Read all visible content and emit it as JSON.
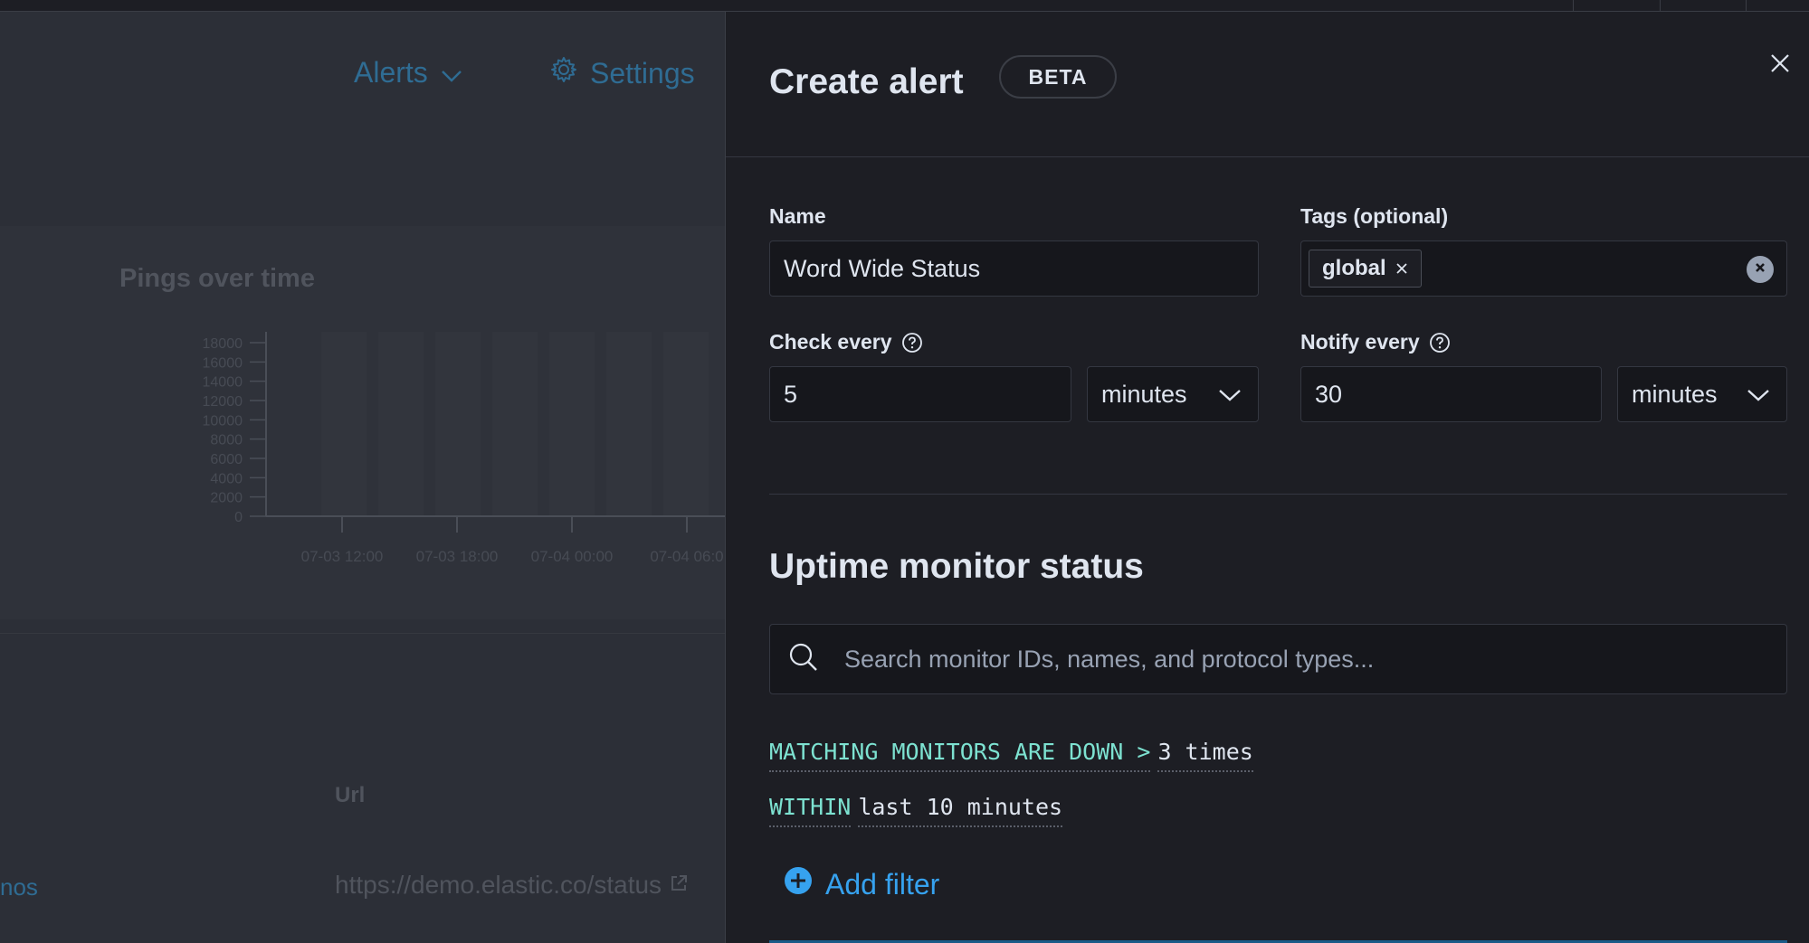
{
  "background": {
    "nav": {
      "alerts_label": "Alerts",
      "settings_label": "Settings"
    },
    "chart": {
      "title": "Pings over time"
    },
    "table": {
      "url_header": "Url",
      "row_left_text": "nos",
      "row_url": "https://demo.elastic.co/status"
    }
  },
  "chart_data": {
    "type": "bar",
    "title": "Pings over time",
    "y_ticks": [
      "18000",
      "16000",
      "14000",
      "12000",
      "10000",
      "8000",
      "6000",
      "4000",
      "2000",
      "0"
    ],
    "x_ticks": [
      "07-03 12:00",
      "07-03 18:00",
      "07-04 00:00",
      "07-04 06:0"
    ],
    "ylim": [
      0,
      18000
    ]
  },
  "flyout": {
    "title": "Create alert",
    "badge": "BETA",
    "name": {
      "label": "Name",
      "value": "Word Wide Status"
    },
    "tags": {
      "label": "Tags (optional)",
      "items": [
        "global"
      ]
    },
    "check_every": {
      "label": "Check every",
      "value": "5",
      "unit": "minutes"
    },
    "notify_every": {
      "label": "Notify every",
      "value": "30",
      "unit": "minutes"
    },
    "section_title": "Uptime monitor status",
    "search": {
      "placeholder": "Search monitor IDs, names, and protocol types..."
    },
    "expression": {
      "line1_keyword": "MATCHING MONITORS ARE DOWN >",
      "line1_value": "3 times",
      "line2_keyword": "WITHIN",
      "line2_value": "last 10 minutes"
    },
    "add_filter_label": "Add filter"
  },
  "colors": {
    "accent": "#36a2ef",
    "keyword": "#7de2d1",
    "flyout_bg": "#1d1e24"
  }
}
